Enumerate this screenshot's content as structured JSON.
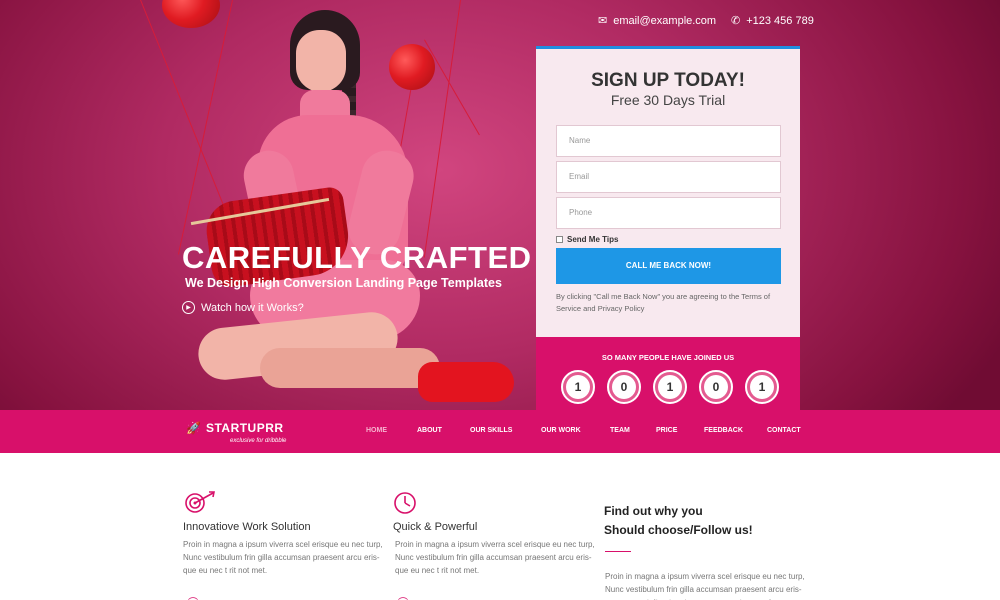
{
  "header": {
    "email": "email@example.com",
    "phone": "+123 456 789",
    "email_icon": "envelope-icon",
    "phone_icon": "phone-icon"
  },
  "hero": {
    "title": "CAREFULLY CRAFTED",
    "subtitle": "We Design High Conversion Landing Page Templates",
    "watch_label": "Watch how it Works?"
  },
  "signup": {
    "title": "SIGN UP TODAY!",
    "subtitle": "Free 30 Days Trial",
    "fields": [
      {
        "placeholder": "Name"
      },
      {
        "placeholder": "Email"
      },
      {
        "placeholder": "Phone"
      }
    ],
    "checkbox_label": "Send Me Tips",
    "button_label": "CALL ME BACK NOW!",
    "terms": "By clicking \"Call me Back Now\" you are agreeing to the Terms of Service and Privacy Policy"
  },
  "counter": {
    "label": "SO MANY PEOPLE HAVE JOINED US",
    "digits": [
      "1",
      "0",
      "1",
      "0",
      "1"
    ]
  },
  "nav": {
    "brand": "STARTUPRR",
    "tagline": "exclusive for dribbble",
    "items": [
      "HOME",
      "ABOUT",
      "OUR SKILLS",
      "OUR WORK",
      "TEAM",
      "PRICE",
      "FEEDBACK",
      "CONTACT"
    ],
    "active": "HOME"
  },
  "features": [
    {
      "icon": "target-arrow-icon",
      "title": "Innovatiove Work Solution",
      "text": "Proin in magna a ipsum viverra scel erisque eu nec turp, Nunc vestibulum frin gilla accumsan praesent arcu eris- que eu nec t rit not met."
    },
    {
      "icon": "clock-icon",
      "title": "Quick & Powerful",
      "text": "Proin in magna a ipsum viverra scel erisque eu nec turp, Nunc vestibulum frin gilla accumsan praesent arcu eris- que eu nec t rit not met."
    }
  ],
  "why": {
    "title_line1": "Find out why you",
    "title_line2": "Should choose/Follow us!",
    "text": "Proin in magna a ipsum viverra scel erisque eu nec turp, Nunc vestibulum frin gilla accumsan praesent arcu eris- que eu nec t rit not met msan praesent arcu eris-"
  },
  "colors": {
    "brand_pink": "#d8106a",
    "cta_blue": "#1e97e6",
    "card_bg": "#f8e9ef"
  }
}
